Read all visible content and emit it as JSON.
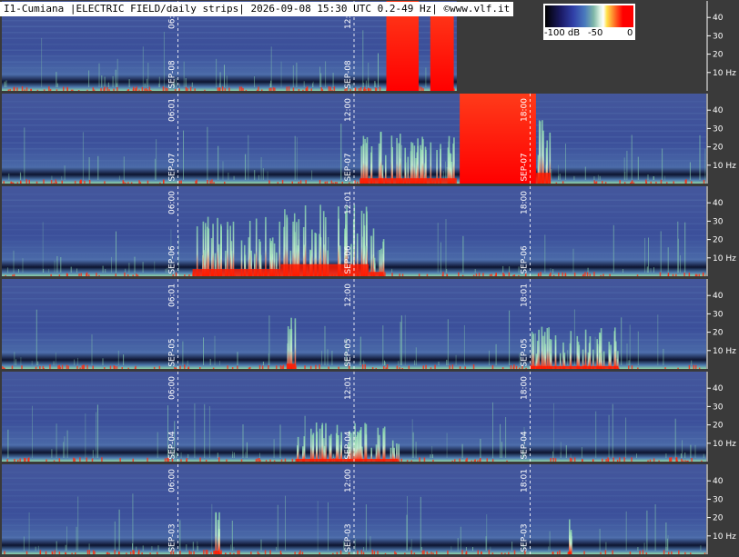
{
  "header": {
    "title": "I1-Cumiana |ELECTRIC FIELD/daily strips| 2026-09-08 15:30 UTC 0.2-49 Hz| ©www.vlf.it"
  },
  "colorbar": {
    "label_min": "-100 dB",
    "label_mid": "-50",
    "label_max": "0"
  },
  "colors": {
    "background": "#3a3a3a",
    "spectrum_base": "#3b4f9a",
    "spectrum_high": "#7fc9a0",
    "saturation": "#ff0000"
  },
  "chart_data": {
    "type": "heatmap",
    "ylim": [
      0,
      49
    ],
    "y_ticks": [
      {
        "value": 40,
        "label": "40"
      },
      {
        "value": 30,
        "label": "30"
      },
      {
        "value": 20,
        "label": "20"
      },
      {
        "value": 10,
        "label": "10 Hz"
      }
    ],
    "xlim_hours": [
      0,
      24
    ],
    "strips": [
      {
        "date_label": "SEP-08",
        "end_hour": 15.5,
        "markers": [
          {
            "hour": 6,
            "time_label": "06:00"
          },
          {
            "hour": 12,
            "time_label": "12:01"
          }
        ],
        "events": [
          [
            13.1,
            14.2,
            1.0
          ],
          [
            14.6,
            15.4,
            0.95
          ]
        ]
      },
      {
        "date_label": "SEP-07",
        "end_hour": 24,
        "markers": [
          {
            "hour": 6,
            "time_label": "06:01"
          },
          {
            "hour": 12,
            "time_label": "12:00"
          },
          {
            "hour": 18,
            "time_label": "18:00"
          }
        ],
        "events": [
          [
            12.2,
            15.5,
            0.45
          ],
          [
            15.6,
            18.2,
            1.0
          ],
          [
            18.2,
            18.7,
            0.7
          ]
        ]
      },
      {
        "date_label": "SEP-06",
        "end_hour": 24,
        "markers": [
          {
            "hour": 6,
            "time_label": "06:00"
          },
          {
            "hour": 12,
            "time_label": "12:01"
          },
          {
            "hour": 18,
            "time_label": "18:00"
          }
        ],
        "events": [
          [
            6.5,
            9.5,
            0.55
          ],
          [
            9.5,
            12.5,
            0.75
          ],
          [
            12.5,
            13.0,
            0.4
          ]
        ]
      },
      {
        "date_label": "SEP-05",
        "end_hour": 24,
        "markers": [
          {
            "hour": 6,
            "time_label": "06:01"
          },
          {
            "hour": 12,
            "time_label": "12:00"
          },
          {
            "hour": 18,
            "time_label": "18:01"
          }
        ],
        "events": [
          [
            9.7,
            10.0,
            0.45
          ],
          [
            18.0,
            21.0,
            0.3
          ]
        ]
      },
      {
        "date_label": "SEP-04",
        "end_hour": 24,
        "markers": [
          {
            "hour": 6,
            "time_label": "06:00"
          },
          {
            "hour": 12,
            "time_label": "12:01"
          },
          {
            "hour": 18,
            "time_label": "18:00"
          }
        ],
        "events": [
          [
            10.0,
            13.5,
            0.25
          ]
        ]
      },
      {
        "date_label": "SEP-03",
        "end_hour": 24,
        "markers": [
          {
            "hour": 6,
            "time_label": "06:00"
          },
          {
            "hour": 12,
            "time_label": "12:00"
          },
          {
            "hour": 18,
            "time_label": "18:01"
          }
        ],
        "events": [
          [
            7.2,
            7.4,
            0.35
          ],
          [
            19.3,
            19.4,
            0.3
          ]
        ]
      }
    ]
  }
}
